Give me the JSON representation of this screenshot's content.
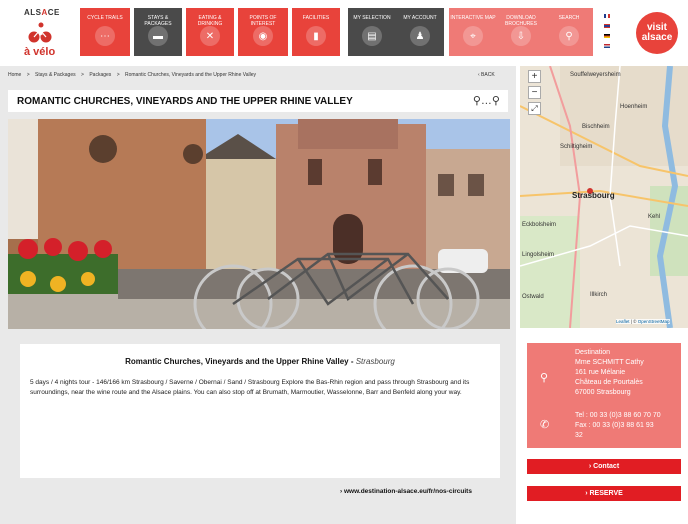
{
  "logo": {
    "brand_pre": "ALS",
    "brand_mid": "A",
    "brand_post": "CE",
    "tagline": "à vélo"
  },
  "nav": [
    {
      "label": "CYCLE TRAILS",
      "icon": "map-pin-trail-icon",
      "color": "red"
    },
    {
      "label": "STAYS & PACKAGES",
      "icon": "bed-icon",
      "color": "dark"
    },
    {
      "label": "EATING & DRINKING",
      "icon": "cutlery-icon",
      "color": "red"
    },
    {
      "label": "POINTS OF INTEREST",
      "icon": "eye-icon",
      "color": "red"
    },
    {
      "label": "FACILITIES",
      "icon": "bottle-icon",
      "color": "red"
    },
    {
      "label": "MY SELECTION",
      "icon": "shopping-cart-icon",
      "color": "dark"
    },
    {
      "label": "MY ACCOUNT",
      "icon": "person-icon",
      "color": "dark"
    },
    {
      "label": "INTERACTIVE MAP",
      "icon": "map-icon",
      "color": "pink"
    },
    {
      "label": "DOWNLOAD BROCHURES",
      "icon": "download-icon",
      "color": "pink"
    },
    {
      "label": "SEARCH",
      "icon": "search-icon",
      "color": "pink"
    }
  ],
  "flags": [
    "fr",
    "en",
    "de",
    "nl"
  ],
  "visit": {
    "line1": "visit",
    "line2": "alsace"
  },
  "breadcrumb": [
    "Home",
    ">",
    "Stays & Packages",
    ">",
    "Packages",
    ">",
    "Romantic Churches, Vineyards and the Upper Rhine Valley"
  ],
  "back_label": "‹  BACK",
  "title": "ROMANTIC CHURCHES, VINEYARDS AND THE UPPER RHINE VALLEY",
  "description": {
    "heading": "Romantic Churches, Vineyards and the Upper Rhine Valley - ",
    "heading_city": "Strasbourg",
    "text": "5 days / 4 nights tour - 146/166 km Strasbourg / Saverne / Obernai / Sand / Strasbourg Explore the Bas-Rhin region and pass through Strasbourg and its surroundings, near the wine route and the Alsace plains. You can also stop off at Brumath, Marmoutier, Wasselonne, Barr and Benfeld along your way."
  },
  "link": "›   www.destination-alsace.eu/fr/nos-circuits",
  "map": {
    "zoom_in": "+",
    "zoom_out": "−",
    "fullscreen": "⤢",
    "labels": [
      "Souffelweyersheim",
      "Hoenheim",
      "Bischheim",
      "Schiltigheim",
      "Strasbourg",
      "Kehl",
      "Illkirch",
      "Lingolsheim",
      "Eckbolsheim",
      "Ostwald"
    ],
    "attribution_leaflet": "Leaflet",
    "attribution_sep": " | © ",
    "attribution_osm": "OpenStreetMap"
  },
  "contact": {
    "dest_lines": [
      "Destination",
      "Mme SCHMITT Cathy",
      "161 rue Mélanie",
      "Château de Pourtalès",
      "67000 Strasbourg"
    ],
    "tel_lines": [
      "Tel : 00 33 (0)3 88 60 70 70",
      "Fax : 00 33 (0)3 88 61 93",
      "32"
    ],
    "contact_label": "›  Contact",
    "reserve_label": "›  RESERVE"
  }
}
